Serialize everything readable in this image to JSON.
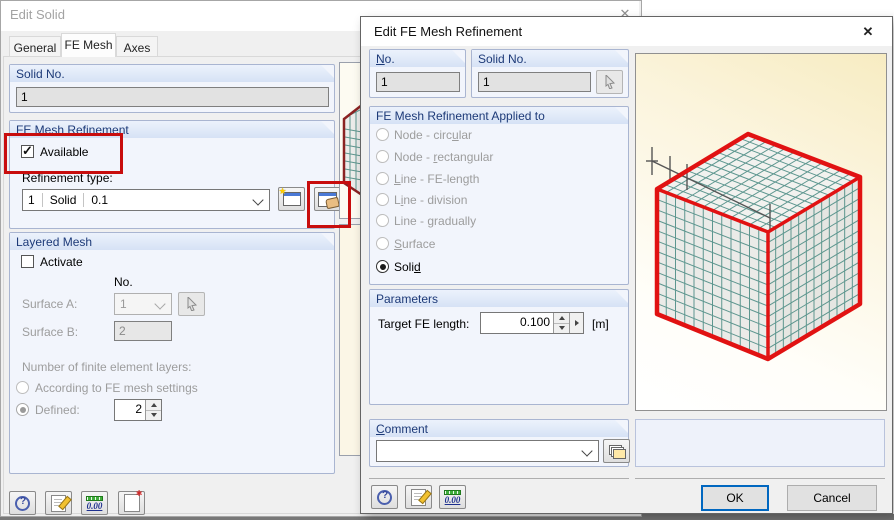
{
  "colors": {
    "annotation_red": "#c80d0d",
    "group_header_text": "#1d3a78",
    "group_background": "#f2f5fc",
    "ok_focus_border": "#0067c0",
    "preview_background_cream": "#f7ecc2",
    "cube_outline_red": "#e11212",
    "mesh_line_teal": "#4e8d85"
  },
  "back_dialog": {
    "title": "Edit Solid",
    "tabs": [
      "General",
      "FE Mesh",
      "Axes"
    ],
    "active_tab": "FE Mesh",
    "solid_no": {
      "header": "Solid No.",
      "value": "1"
    },
    "refinement": {
      "header": "FE Mesh Refinement",
      "available_label": "Available",
      "available_checked": true,
      "type_label": "Refinement type:",
      "type_no": "1",
      "type_kind": "Solid",
      "type_param": "0.1"
    },
    "layered": {
      "header": "Layered Mesh",
      "activate_label": "Activate",
      "activate_checked": false,
      "no_col_label": "No.",
      "surface_a_label": "Surface A:",
      "surface_a_value": "1",
      "surface_b_label": "Surface B:",
      "surface_b_value": "2",
      "layers_label": "Number of finite element layers:",
      "option_auto": "According to FE mesh settings",
      "option_defined": "Defined:",
      "defined_value": "2",
      "selected_option": "Defined"
    }
  },
  "front_dialog": {
    "title": "Edit FE Mesh Refinement",
    "no_group": {
      "header_html": "<u>N</u>o.",
      "value": "1"
    },
    "solid_group": {
      "header": "Solid No.",
      "value": "1"
    },
    "applied": {
      "header": "FE Mesh Refinement Applied to",
      "selected": "Solid",
      "options": [
        {
          "html": "Node - circ<u>u</u>lar",
          "enabled": false,
          "selected": false
        },
        {
          "html": "Node - <u>r</u>ectangular",
          "enabled": false,
          "selected": false
        },
        {
          "html": "<u>L</u>ine - FE-length",
          "enabled": false,
          "selected": false
        },
        {
          "html": "L<u>i</u>ne - division",
          "enabled": false,
          "selected": false
        },
        {
          "html": "Line - <u>g</u>radually",
          "enabled": false,
          "selected": false
        },
        {
          "html": "<u>S</u>urface",
          "enabled": false,
          "selected": false
        },
        {
          "html": "Soli<u>d</u>",
          "enabled": true,
          "selected": true
        }
      ]
    },
    "parameters": {
      "header": "Parameters",
      "label": "Target FE length:",
      "value": "0.100",
      "unit": "[m]"
    },
    "comment": {
      "header_html": "<u>C</u>omment",
      "value": ""
    },
    "buttons": {
      "ok": "OK",
      "cancel": "Cancel"
    }
  }
}
